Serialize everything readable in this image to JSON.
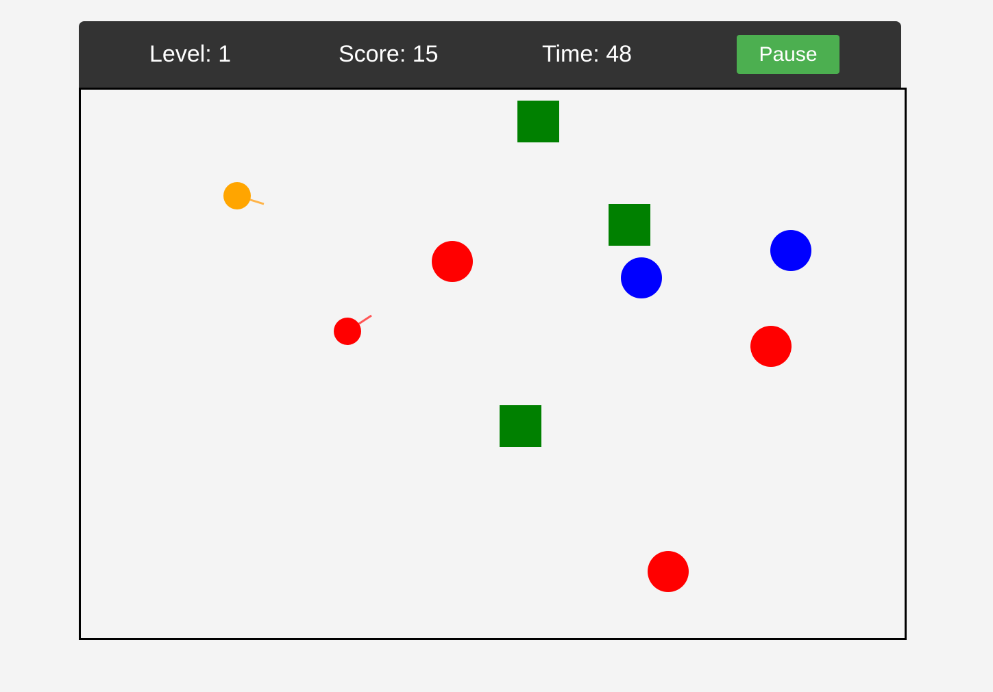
{
  "hud": {
    "level_label": "Level: ",
    "level_value": "1",
    "score_label": "Score: ",
    "score_value": "15",
    "time_label": "Time: ",
    "time_value": "48",
    "pause_label": "Pause"
  },
  "colors": {
    "hud_background": "#333333",
    "pause_button": "#4caf50",
    "field_background": "#f4f4f4",
    "field_border": "#000000",
    "square": "#008000",
    "red": "#ff0000",
    "blue": "#0000ff",
    "orange": "#ffa500"
  },
  "entities": {
    "green_squares": 3,
    "red_circles": 3,
    "blue_circles": 2,
    "shooters": [
      {
        "color": "orange",
        "name": "orange-shooter"
      },
      {
        "color": "red",
        "name": "red-shooter"
      }
    ]
  }
}
